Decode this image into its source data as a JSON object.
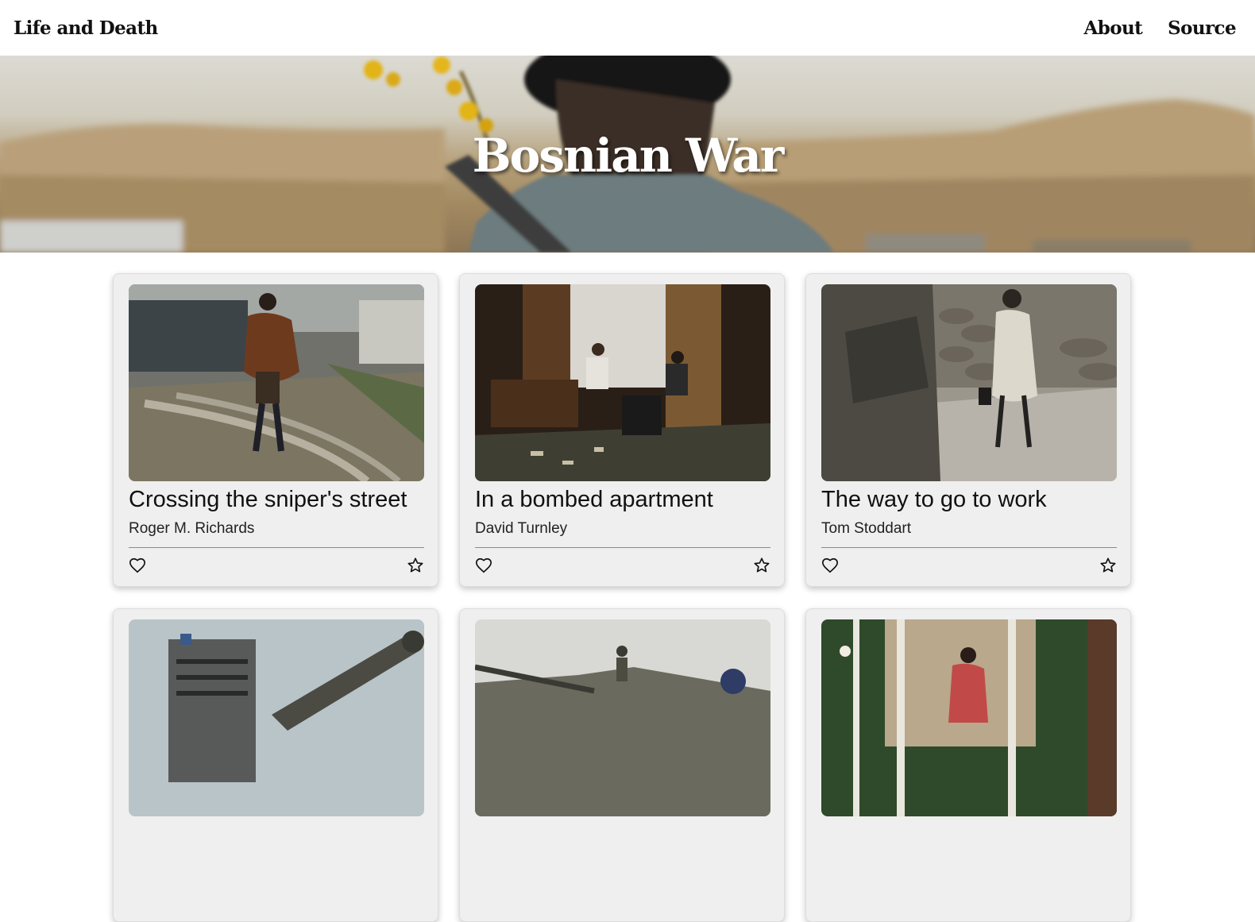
{
  "nav": {
    "brand": "Life and Death",
    "links": [
      "About",
      "Source"
    ]
  },
  "hero": {
    "title": "Bosnian War"
  },
  "cards": [
    {
      "title": "Crossing the sniper's street",
      "author": "Roger M. Richards"
    },
    {
      "title": "In a bombed apartment",
      "author": "David Turnley"
    },
    {
      "title": "The way to go to work",
      "author": "Tom Stoddart"
    },
    {
      "title": "",
      "author": ""
    },
    {
      "title": "",
      "author": ""
    },
    {
      "title": "",
      "author": ""
    }
  ],
  "icons": {
    "like": "heart-outline-icon",
    "favorite": "star-outline-icon"
  }
}
